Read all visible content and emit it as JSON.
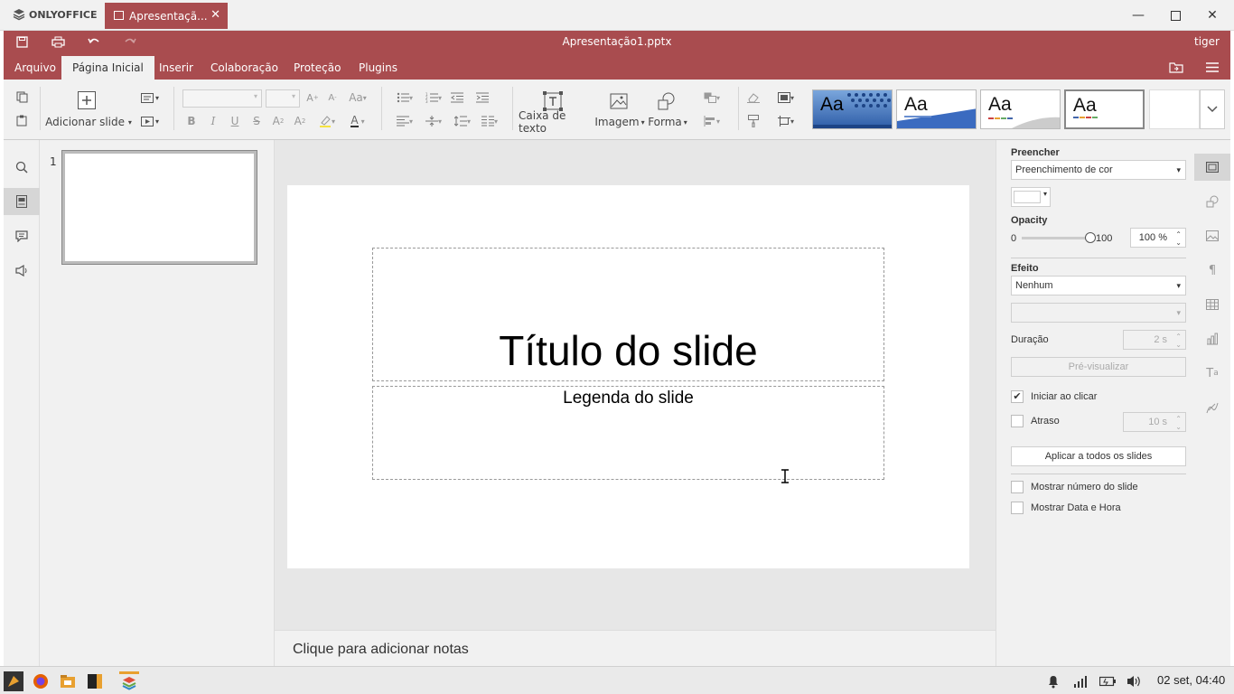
{
  "titlebar": {
    "app_name": "ONLYOFFICE",
    "tab_label": "Apresentaçã...",
    "minimize_icon": "minimize-icon",
    "maximize_icon": "maximize-icon",
    "close_icon": "close-icon"
  },
  "header": {
    "doc_title": "Apresentação1.pptx",
    "user": "tiger",
    "menu": [
      "Arquivo",
      "Página Inicial",
      "Inserir",
      "Colaboração",
      "Proteção",
      "Plugins"
    ],
    "active_menu": "Página Inicial"
  },
  "toolbar": {
    "add_slide": "Adicionar slide",
    "text_box": "Caixa de texto",
    "image": "Imagem",
    "shape": "Forma",
    "themes": [
      "Aa",
      "Aa",
      "Aa",
      "Aa"
    ]
  },
  "thumbnails": {
    "slide_number": "1"
  },
  "slide": {
    "title": "Título do slide",
    "subtitle": "Legenda do slide"
  },
  "notes": {
    "placeholder": "Clique para adicionar notas"
  },
  "right_panel": {
    "fill_label": "Preencher",
    "fill_value": "Preenchimento de cor",
    "opacity_label": "Opacity",
    "opacity_min": "0",
    "opacity_max": "100",
    "opacity_value": "100 %",
    "opacity_level_percent": 100,
    "effect_label": "Efeito",
    "effect_value": "Nenhum",
    "duration_label": "Duração",
    "duration_value": "2 s",
    "preview_button": "Pré-visualizar",
    "start_on_click": "Iniciar ao clicar",
    "start_on_click_checked": true,
    "delay_label": "Atraso",
    "delay_value": "10 s",
    "apply_all_button": "Aplicar a todos os slides",
    "show_slide_number": "Mostrar número do slide",
    "show_date_time": "Mostrar Data e Hora"
  },
  "taskbar": {
    "clock": "02 set, 04:40"
  },
  "colors": {
    "accent": "#a94c4f",
    "panel_bg": "#f1f1f1",
    "canvas_bg": "#e7e7e7"
  }
}
